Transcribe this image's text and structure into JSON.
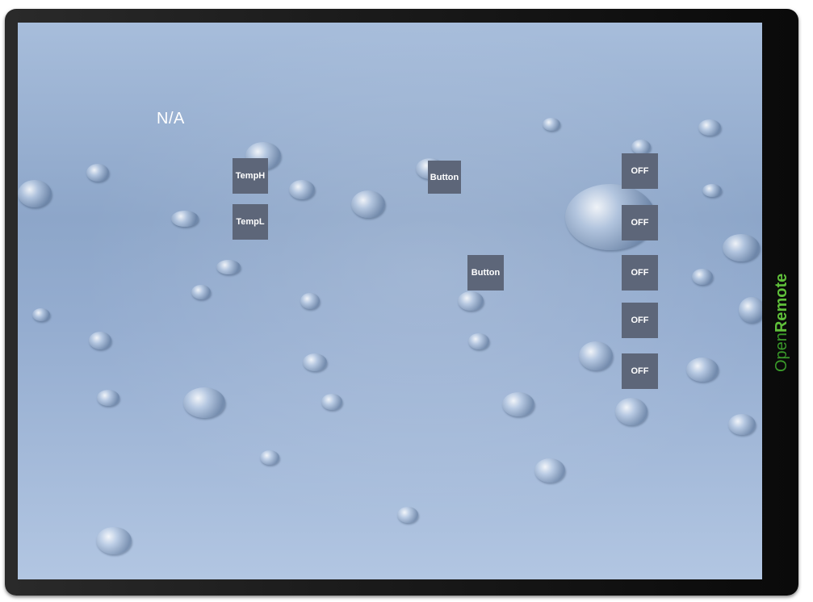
{
  "screen": {
    "status_label": "N/A"
  },
  "buttons": {
    "temp_high": "TempH",
    "temp_low": "TempL",
    "button_1": "Button",
    "button_2": "Button"
  },
  "switches": [
    {
      "label": "OFF"
    },
    {
      "label": "OFF"
    },
    {
      "label": "OFF"
    },
    {
      "label": "OFF"
    },
    {
      "label": "OFF"
    }
  ],
  "branding": {
    "logo_part1": "Open",
    "logo_part2": "Remote",
    "logo_color1": "#3a9a2a",
    "logo_color2": "#5fbf3a"
  },
  "colors": {
    "button_bg": "#5d6679",
    "frame": "#1c1c1c"
  }
}
